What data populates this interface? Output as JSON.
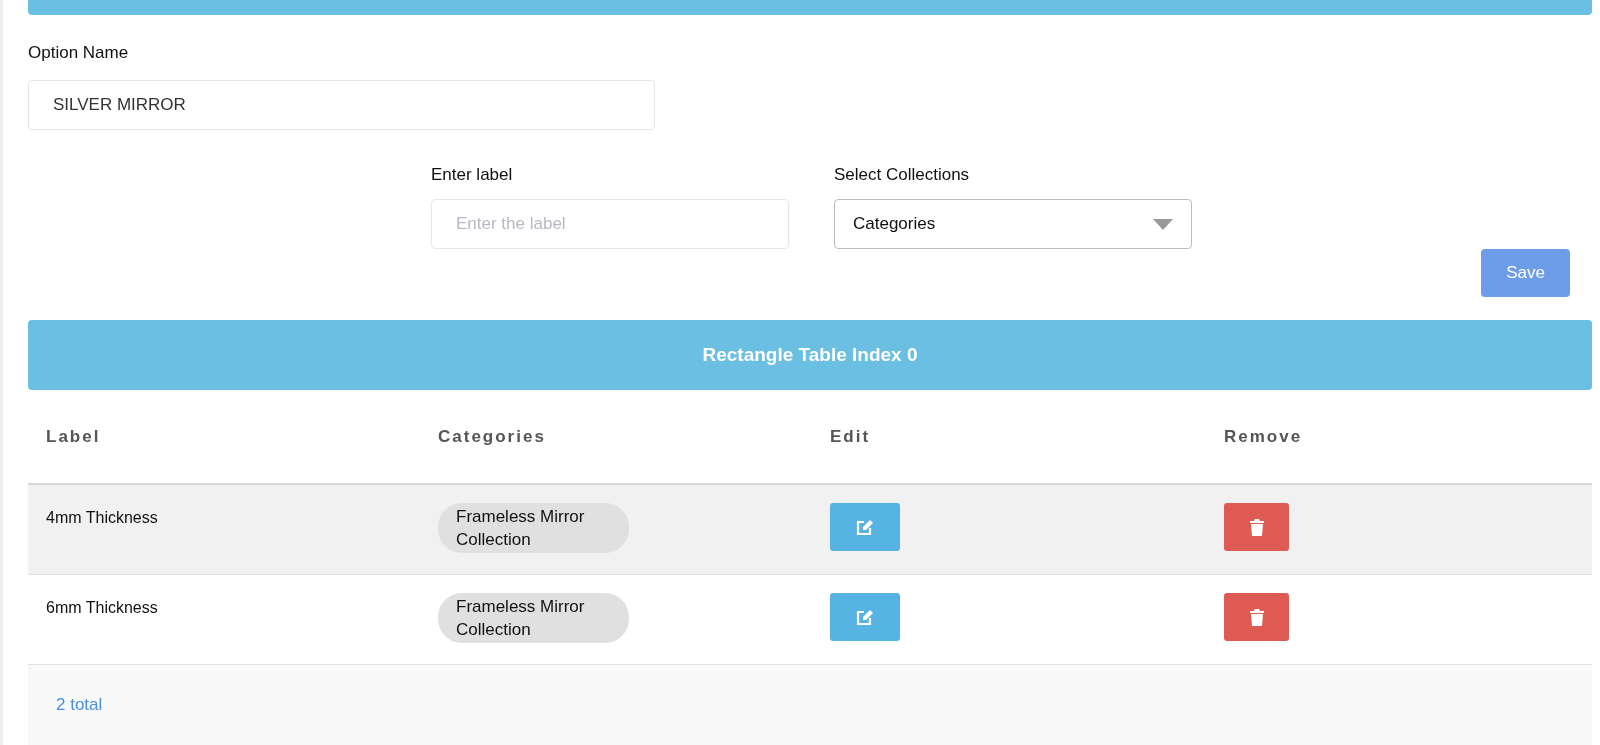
{
  "option_name": {
    "label": "Option Name",
    "value": "SILVER MIRROR"
  },
  "label_field": {
    "label": "Enter label",
    "placeholder": "Enter the label"
  },
  "collections_select": {
    "label": "Select Collections",
    "value": "Categories"
  },
  "save_button": "Save",
  "table": {
    "title": "Rectangle Table Index 0",
    "columns": [
      "Label",
      "Categories",
      "Edit",
      "Remove"
    ],
    "rows": [
      {
        "label": "4mm Thickness",
        "categories": [
          "Frameless Mirror Collection"
        ]
      },
      {
        "label": "6mm Thickness",
        "categories": [
          "Frameless Mirror Collection"
        ]
      }
    ],
    "total": "2 total"
  }
}
